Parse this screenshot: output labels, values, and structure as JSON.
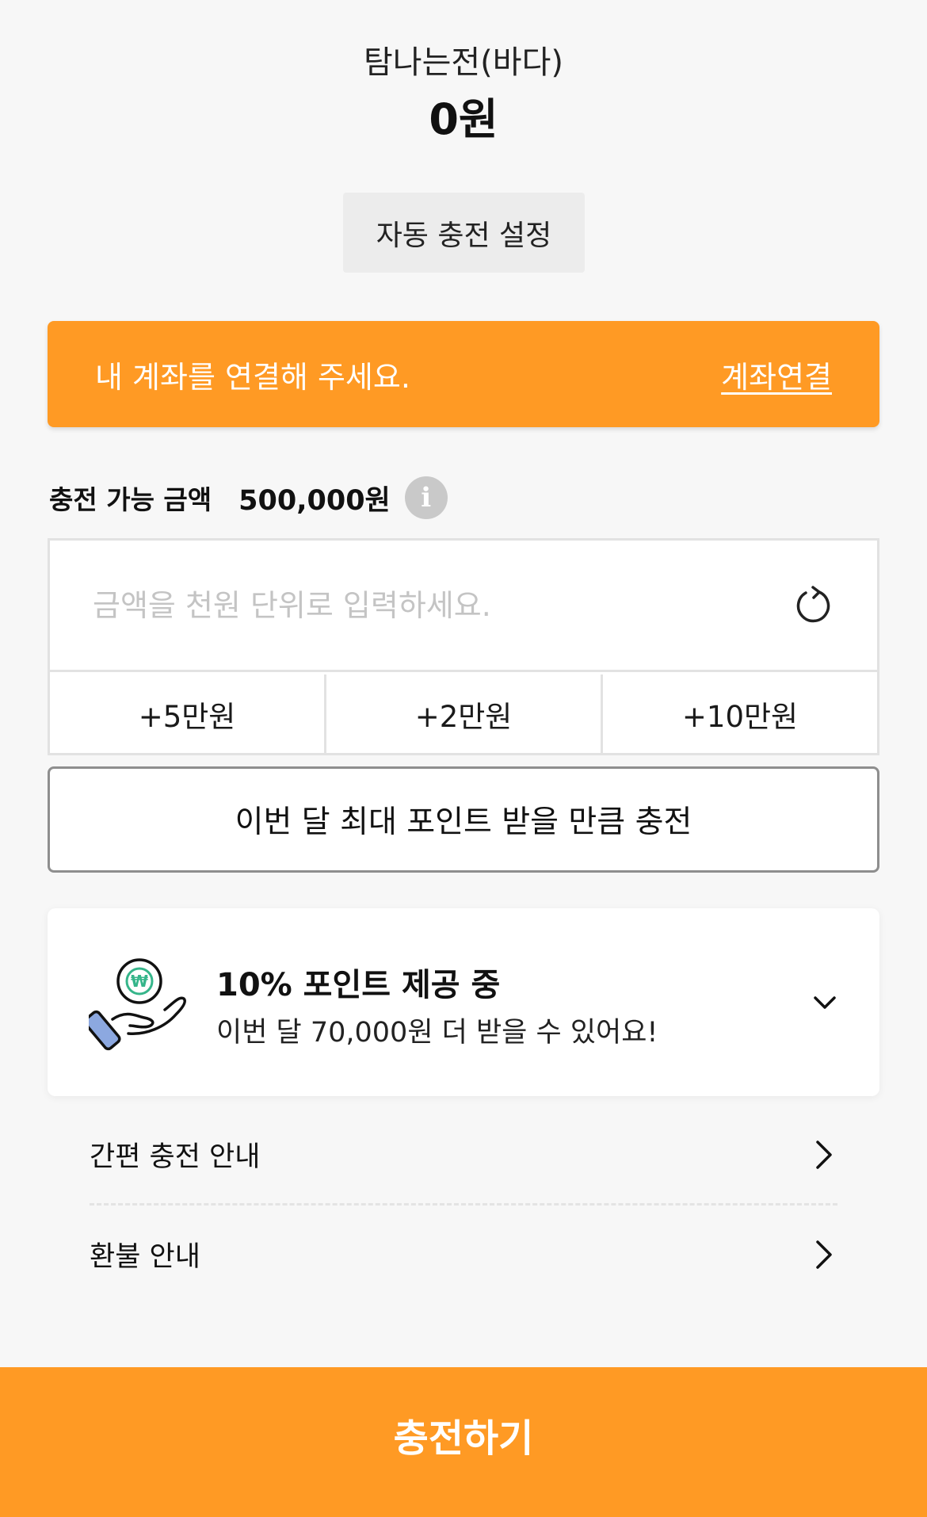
{
  "wallet": {
    "name": "탐나는전(바다)",
    "balance": "0원"
  },
  "auto_charge": {
    "label": "자동 충전 설정"
  },
  "account_banner": {
    "message": "내 계좌를 연결해 주세요.",
    "link_label": "계좌연결",
    "color": "#ff9a24"
  },
  "charge_limit": {
    "label": "충전 가능 금액",
    "amount": "500,000원",
    "info_icon": "i"
  },
  "amount_input": {
    "value": "",
    "placeholder": "금액을 천원 단위로 입력하세요."
  },
  "quick_amounts": [
    "+5만원",
    "+2만원",
    "+10만원"
  ],
  "max_point_button": {
    "label": "이번 달 최대 포인트 받을 만큼 충전"
  },
  "point_card": {
    "icon": "hand-coin-icon",
    "title": "10% 포인트 제공 중",
    "subtitle": "이번 달 70,000원 더 받을 수 있어요!"
  },
  "info_items": [
    {
      "label": "간편 충전 안내"
    },
    {
      "label": "환불 안내"
    }
  ],
  "charge_button": {
    "label": "충전하기"
  },
  "colors": {
    "accent": "#ff9a24",
    "coin_green": "#35b58a",
    "icon_blue": "#8ca8e0"
  }
}
